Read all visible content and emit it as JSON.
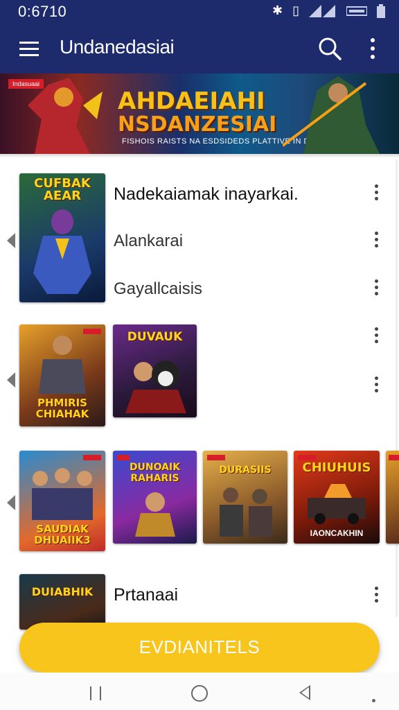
{
  "status": {
    "time": "0:6710",
    "icons": [
      "bluetooth-icon",
      "vibrate-icon",
      "signal-icon",
      "battery-icon"
    ]
  },
  "appbar": {
    "title": "Undanedasiai",
    "menu_icon": "hamburger-menu-icon",
    "search_icon": "search-icon",
    "more_icon": "more-vertical-icon"
  },
  "banner": {
    "tag": "Indasuaai",
    "line1": "AHDAEIAHI",
    "line2": "NSDANZESIAI",
    "subtitle": "FISHOIS RAISTS NA ESDSIDEDS PLATTIVE IN DSOIN"
  },
  "rows": [
    {
      "title": "Nadekaiamak inayarkai.",
      "thumb_caption": "CUFBAK AEAR"
    },
    {
      "label": "Alankarai"
    },
    {
      "label": "Gayallcaisis"
    }
  ],
  "carousel2": [
    {
      "caption": "PHMIRIS CHIAHAK"
    },
    {
      "caption": "DUVAUK"
    }
  ],
  "carousel3": [
    {
      "caption": "SAUDIAK DHUAIIK3"
    },
    {
      "caption": "DUNOAIK RAHARIS"
    },
    {
      "caption": "DURASIIS"
    },
    {
      "caption": "CHIUHUIS",
      "subcaption": "IAONCAKHIN"
    }
  ],
  "last_row": {
    "title": "Prtanaai",
    "thumb_caption": "DUIABHIK"
  },
  "fab": {
    "label": "EVDIANITELS"
  },
  "colors": {
    "appbar": "#1d2a6b",
    "accent": "#f7c51b"
  }
}
